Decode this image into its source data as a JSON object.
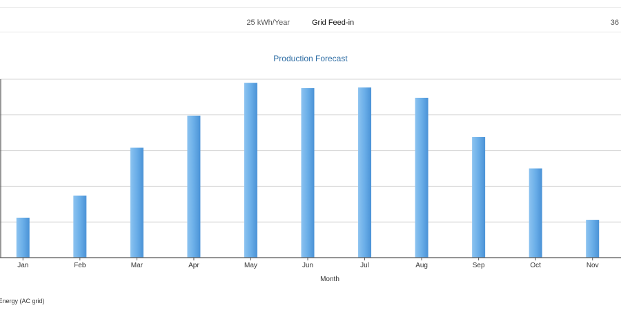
{
  "summary_row": {
    "value_left": "25 kWh/Year",
    "label": "Grid Feed-in",
    "value_right": "36"
  },
  "chart_data": {
    "type": "bar",
    "title": "Production Forecast",
    "xlabel": "Month",
    "ylabel": "",
    "categories": [
      "Jan",
      "Feb",
      "Mar",
      "Apr",
      "May",
      "Jun",
      "Jul",
      "Aug",
      "Sep",
      "Oct",
      "Nov"
    ],
    "series": [
      {
        "name": "Energy (AC grid)",
        "values": [
          1.12,
          1.74,
          3.08,
          3.98,
          4.9,
          4.75,
          4.77,
          4.48,
          3.38,
          2.5,
          1.06
        ]
      }
    ],
    "ylim": [
      0,
      5
    ],
    "grid": true,
    "legend_position": "bottom-left",
    "colors": {
      "bar": "#6aaee8",
      "bar_dark": "#4a92d6",
      "title": "#2e6da4",
      "grid": "#d4d4d4",
      "axis": "#555555"
    }
  },
  "legend": {
    "text": "r Energy (AC grid)"
  }
}
